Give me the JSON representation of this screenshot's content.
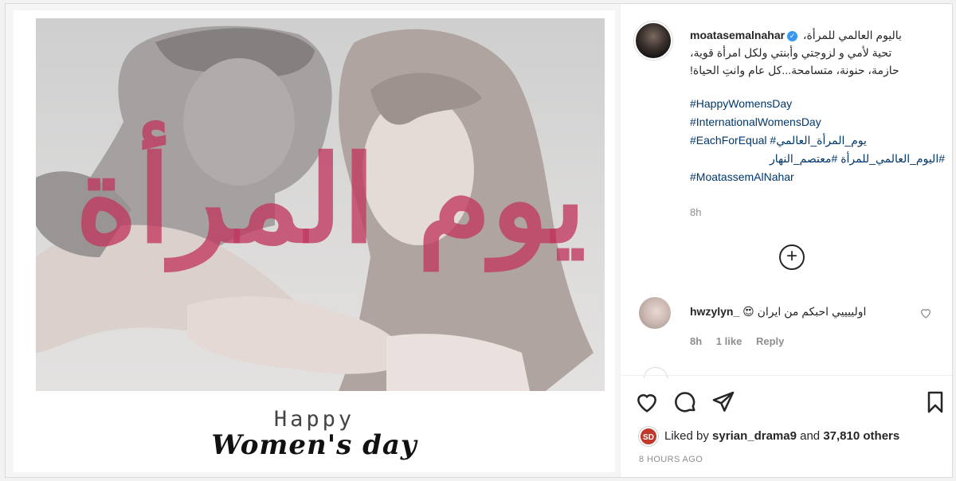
{
  "post": {
    "image": {
      "overlay_calligraphy": "يوم المرأة",
      "happy_text": "Happy",
      "womens_day_text": "Women's day",
      "calligraphy_color": "#c0395f"
    }
  },
  "author": {
    "username": "moatasemalnahar",
    "verified_icon": "verified-badge"
  },
  "caption": {
    "lines": [
      "باليوم العالمي للمرأة،",
      "تحية لأمي و لزوجتي وأبنتي ولكل امرأة قوية،",
      "حازمة، حنونة، متسامحة...كل عام وانتِ الحياة!"
    ],
    "hashtags": [
      "#HappyWomensDay",
      "#InternationalWomensDay",
      "#EachForEqual #يوم_المرأة_العالمي",
      "#اليوم_العالمي_للمرأة #معتصم_النهار",
      "#MoatassemAlNahar"
    ],
    "time": "8h"
  },
  "load_more_icon": "plus-circle-icon",
  "comment": {
    "username": "hwzylyn_",
    "text": "اولييييي احبكم من ايران 😍",
    "time": "8h",
    "likes": "1 like",
    "reply": "Reply"
  },
  "actions": {
    "like_icon": "heart-icon",
    "comment_icon": "comment-icon",
    "share_icon": "share-icon",
    "save_icon": "bookmark-icon"
  },
  "likes": {
    "badge": "SD",
    "prefix": "Liked by",
    "user": "syrian_drama9",
    "and": "and",
    "count": "37,810 others"
  },
  "posted_ago": "8 HOURS AGO"
}
